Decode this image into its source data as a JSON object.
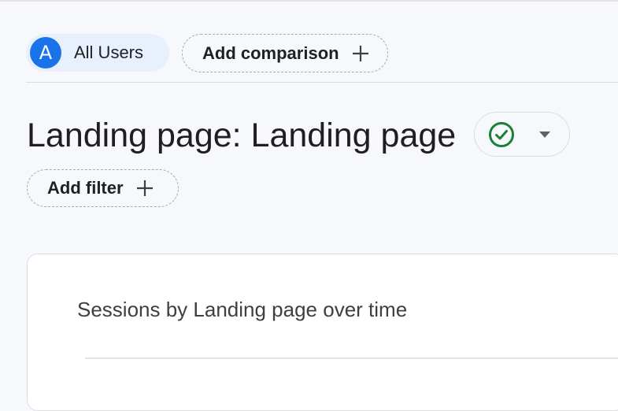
{
  "comparison_bar": {
    "segment": {
      "avatar_letter": "A",
      "label": "All Users"
    },
    "add_comparison_label": "Add comparison"
  },
  "report": {
    "title": "Landing page: Landing page",
    "status_icon": "check-circle-icon",
    "add_filter_label": "Add filter"
  },
  "card": {
    "title": "Sessions by Landing page over time"
  },
  "colors": {
    "accent_blue": "#1a73e8",
    "segment_chip_bg": "#e8f0fe",
    "status_green": "#188038",
    "page_bg": "#f6f8fb"
  }
}
